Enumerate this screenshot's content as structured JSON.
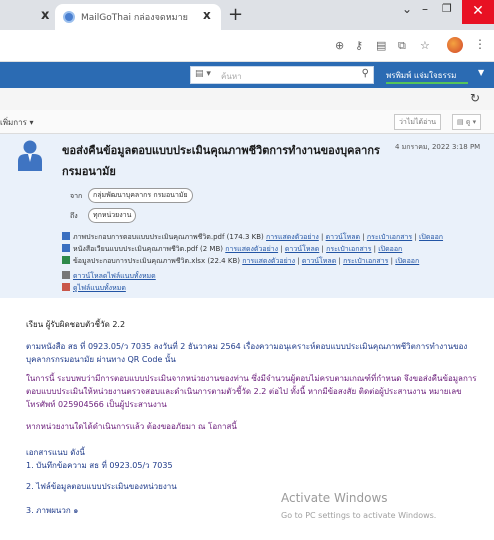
{
  "browser": {
    "tab_title": "MailGoThai กล่องจดหมาย",
    "prev_tab_close": "x",
    "tab_close": "x",
    "new_tab": "+",
    "minimize": "–",
    "maximize": "❐",
    "close": "✕",
    "dropdown": "⌄"
  },
  "owa": {
    "search_placeholder": "ค้นหา",
    "user_name": "พรพิมพ์ แจ่มใจธรรม"
  },
  "actions": {
    "menu_label": "เพิ่มการ",
    "mark_label": "ว่าไม่ได้อ่าน",
    "view_label": "ดู"
  },
  "message": {
    "subject": "ขอส่งคืนข้อมูลตอบแบบประเมินคุณภาพชีวิตการทำงานของบุคลากร กรมอนามัย",
    "date": "4 มกราคม, 2022 3:18 PM",
    "from_label": "จาก",
    "from_value": "กลุ่มพัฒนาบุคลากร กรมอนามัย",
    "to_label": "ถึง",
    "to_value": "ทุกหน่วยงาน",
    "attachments": [
      {
        "name": "ภาพประกอบการตอบแบบประเมินคุณภาพชีวิต.pdf (174.3 KB)",
        "links": [
          "การแสดงตัวอย่าง",
          "ดาวน์โหลด",
          "กระเป๋าเอกสาร",
          "เปิดออก"
        ]
      },
      {
        "name": "หนังสือเวียนแบบประเมินคุณภาพชีวิต.pdf (2 MB)",
        "links": [
          "การแสดงตัวอย่าง",
          "ดาวน์โหลด",
          "กระเป๋าเอกสาร",
          "เปิดออก"
        ]
      },
      {
        "name": "ข้อมูลประกอบการประเมินคุณภาพชีวิต.xlsx (22.4 KB)",
        "links": [
          "การแสดงตัวอย่าง",
          "ดาวน์โหลด",
          "กระเป๋าเอกสาร",
          "เปิดออก"
        ]
      }
    ],
    "download_all": "ดาวน์โหลดไฟล์แนบทั้งหมด",
    "view_all": "ดูไฟล์แนบทั้งหมด",
    "body": {
      "greeting": "เรียน ผู้รับผิดชอบตัวชี้วัด 2.2",
      "para1": "ตามหนังสือ สธ ที่ 0923.05/ว 7035 ลงวันที่ 2 ธันวาคม 2564 เรื่องความอนุเคราะห์ตอบแบบประเมินคุณภาพชีวิตการทำงานของบุคลากรกรมอนามัย ผ่านทาง QR Code นั้น",
      "para2": "ในการนี้ ระบบพบว่ามีการตอบแบบประเมินจากหน่วยงานของท่าน ซึ่งมีจำนวนผู้ตอบไม่ครบตามเกณฑ์ที่กำหนด จึงขอส่งคืนข้อมูลการตอบแบบประเมินให้หน่วยงานตรวจสอบและดำเนินการตามตัวชี้วัด 2.2 ต่อไป ทั้งนี้ หากมีข้อสงสัย ติดต่อผู้ประสานงาน หมายเลขโทรศัพท์ 025904566 เป็นผู้ประสานงาน",
      "para3": "หากหน่วยงานใดได้ดำเนินการแล้ว ต้องขออภัยมา ณ โอกาสนี้",
      "list_title": "เอกสารแนบ ดังนี้",
      "item1": "1. บันทึกข้อความ สธ ที่ 0923.05/ว 7035",
      "item2": "2. ไฟล์ข้อมูลตอบแบบประเมินของหน่วยงาน",
      "item3": "3. ภาพผนวก ๑"
    }
  },
  "watermark": {
    "title": "Activate Windows",
    "subtitle": "Go to PC settings to activate Windows."
  }
}
